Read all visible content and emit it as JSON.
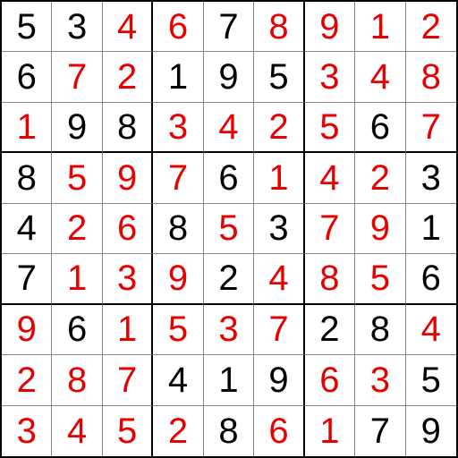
{
  "sudoku": {
    "cells": [
      [
        {
          "v": "5",
          "given": true
        },
        {
          "v": "3",
          "given": true
        },
        {
          "v": "4",
          "given": false
        },
        {
          "v": "6",
          "given": false
        },
        {
          "v": "7",
          "given": true
        },
        {
          "v": "8",
          "given": false
        },
        {
          "v": "9",
          "given": false
        },
        {
          "v": "1",
          "given": false
        },
        {
          "v": "2",
          "given": false
        }
      ],
      [
        {
          "v": "6",
          "given": true
        },
        {
          "v": "7",
          "given": false
        },
        {
          "v": "2",
          "given": false
        },
        {
          "v": "1",
          "given": true
        },
        {
          "v": "9",
          "given": true
        },
        {
          "v": "5",
          "given": true
        },
        {
          "v": "3",
          "given": false
        },
        {
          "v": "4",
          "given": false
        },
        {
          "v": "8",
          "given": false
        }
      ],
      [
        {
          "v": "1",
          "given": false
        },
        {
          "v": "9",
          "given": true
        },
        {
          "v": "8",
          "given": true
        },
        {
          "v": "3",
          "given": false
        },
        {
          "v": "4",
          "given": false
        },
        {
          "v": "2",
          "given": false
        },
        {
          "v": "5",
          "given": false
        },
        {
          "v": "6",
          "given": true
        },
        {
          "v": "7",
          "given": false
        }
      ],
      [
        {
          "v": "8",
          "given": true
        },
        {
          "v": "5",
          "given": false
        },
        {
          "v": "9",
          "given": false
        },
        {
          "v": "7",
          "given": false
        },
        {
          "v": "6",
          "given": true
        },
        {
          "v": "1",
          "given": false
        },
        {
          "v": "4",
          "given": false
        },
        {
          "v": "2",
          "given": false
        },
        {
          "v": "3",
          "given": true
        }
      ],
      [
        {
          "v": "4",
          "given": true
        },
        {
          "v": "2",
          "given": false
        },
        {
          "v": "6",
          "given": false
        },
        {
          "v": "8",
          "given": true
        },
        {
          "v": "5",
          "given": false
        },
        {
          "v": "3",
          "given": true
        },
        {
          "v": "7",
          "given": false
        },
        {
          "v": "9",
          "given": false
        },
        {
          "v": "1",
          "given": true
        }
      ],
      [
        {
          "v": "7",
          "given": true
        },
        {
          "v": "1",
          "given": false
        },
        {
          "v": "3",
          "given": false
        },
        {
          "v": "9",
          "given": false
        },
        {
          "v": "2",
          "given": true
        },
        {
          "v": "4",
          "given": false
        },
        {
          "v": "8",
          "given": false
        },
        {
          "v": "5",
          "given": false
        },
        {
          "v": "6",
          "given": true
        }
      ],
      [
        {
          "v": "9",
          "given": false
        },
        {
          "v": "6",
          "given": true
        },
        {
          "v": "1",
          "given": false
        },
        {
          "v": "5",
          "given": false
        },
        {
          "v": "3",
          "given": false
        },
        {
          "v": "7",
          "given": false
        },
        {
          "v": "2",
          "given": true
        },
        {
          "v": "8",
          "given": true
        },
        {
          "v": "4",
          "given": false
        }
      ],
      [
        {
          "v": "2",
          "given": false
        },
        {
          "v": "8",
          "given": false
        },
        {
          "v": "7",
          "given": false
        },
        {
          "v": "4",
          "given": true
        },
        {
          "v": "1",
          "given": true
        },
        {
          "v": "9",
          "given": true
        },
        {
          "v": "6",
          "given": false
        },
        {
          "v": "3",
          "given": false
        },
        {
          "v": "5",
          "given": true
        }
      ],
      [
        {
          "v": "3",
          "given": false
        },
        {
          "v": "4",
          "given": false
        },
        {
          "v": "5",
          "given": false
        },
        {
          "v": "2",
          "given": false
        },
        {
          "v": "8",
          "given": true
        },
        {
          "v": "6",
          "given": false
        },
        {
          "v": "1",
          "given": false
        },
        {
          "v": "7",
          "given": true
        },
        {
          "v": "9",
          "given": true
        }
      ]
    ]
  }
}
